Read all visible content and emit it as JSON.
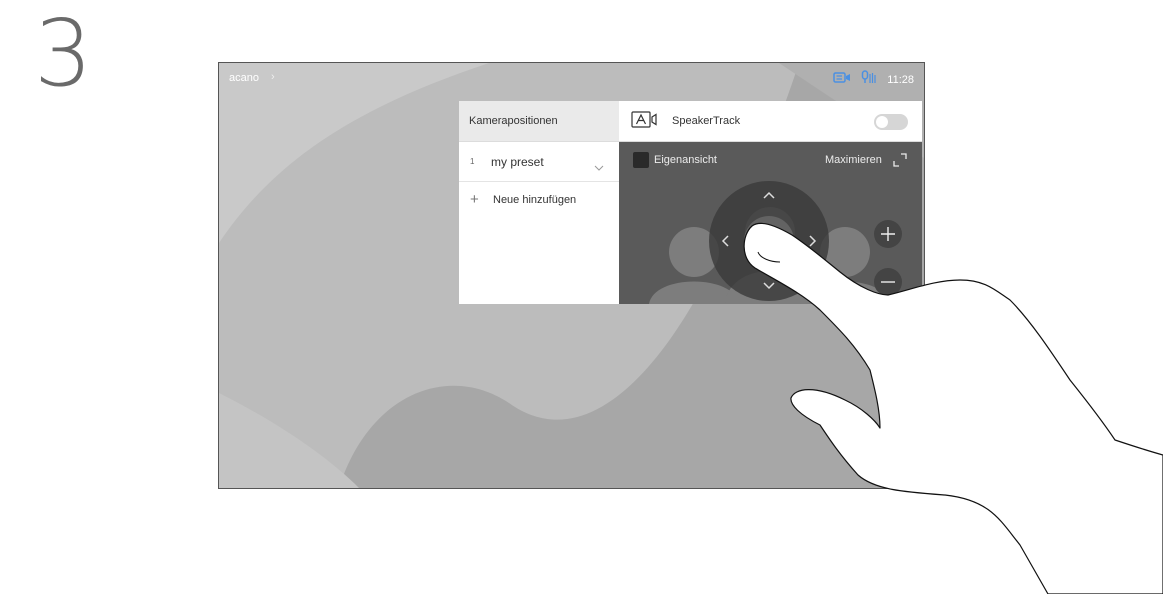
{
  "step": {
    "number": "3"
  },
  "topbar": {
    "system_name": "acano",
    "time": "11:28",
    "icons": [
      "camera-icon",
      "microphone-icon"
    ]
  },
  "presets": {
    "header": "Kamerapositionen",
    "items": [
      {
        "index": "1",
        "name": "my preset"
      }
    ],
    "add_label": "Neue hinzufügen"
  },
  "camera": {
    "speakertrack_label": "SpeakerTrack",
    "speakertrack_on": false,
    "selfview_label": "Eigenansicht",
    "maximize_label": "Maximieren",
    "controls": [
      "up",
      "down",
      "left",
      "right",
      "zoom-in",
      "zoom-out"
    ]
  },
  "colors": {
    "accent_icon": "#4a90e2",
    "panel_dark": "#5a5a5a",
    "background": "#b9b9b9"
  }
}
